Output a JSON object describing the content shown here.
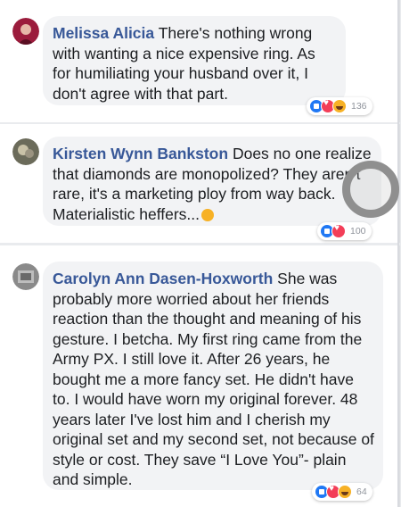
{
  "comments": [
    {
      "author": "Melissa Alicia",
      "text": "There's nothing wrong with wanting a nice expensive ring. As for humiliating your husband over it, I don't agree with that part.",
      "reaction_count": "136",
      "reactions": [
        "like-icon",
        "love-icon",
        "haha-icon"
      ],
      "avatar_color": "#9b1c3c"
    },
    {
      "author": "Kirsten Wynn Bankston",
      "text": "Does no one realize that diamonds are monopolized? They aren't rare, it's a marketing ploy from way back. Materialistic heffers...",
      "reaction_count": "100",
      "reactions": [
        "like-icon",
        "love-icon"
      ],
      "avatar_color": "#6b6b5a"
    },
    {
      "author": "Carolyn Ann Dasen-Hoxworth",
      "text": "She was probably more worried about her friends reaction than the thought and meaning of his gesture. I betcha. My first ring came from the Army PX. I still love it. After 26 years, he bought me a more fancy set. He didn't have to. I would have worn my original forever. 48 years later I've lost him and I cherish my original set and my second set, not because of style or cost. They save “I Love You”- plain and simple.",
      "reaction_count": "64",
      "reactions": [
        "like-icon",
        "love-icon",
        "haha-icon"
      ],
      "avatar_color": "#8a8a8a"
    }
  ],
  "colors": {
    "author": "#385898",
    "bubble": "#f2f3f5",
    "background": "#e9ebee"
  }
}
